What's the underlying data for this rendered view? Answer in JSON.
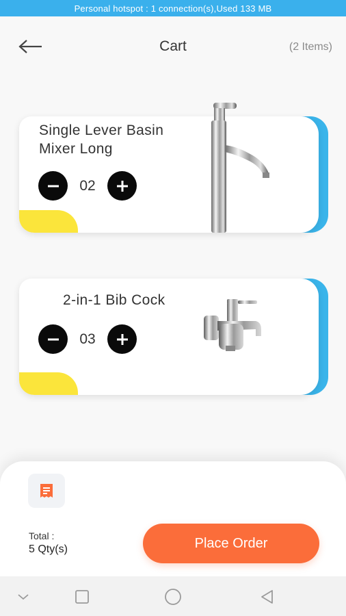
{
  "status_bar": {
    "text": "Personal hotspot : 1 connection(s),Used  133 MB"
  },
  "header": {
    "title": "Cart",
    "item_count": "(2 Items)",
    "back_icon": "arrow-left-icon"
  },
  "cart_items": [
    {
      "name_line1": "Single Lever Basin",
      "name_line2": "Mixer Long",
      "quantity": "02",
      "image": "basin-mixer-faucet"
    },
    {
      "name_line1": "2-in-1 Bib Cock",
      "quantity": "03",
      "image": "bib-cock-faucet"
    }
  ],
  "summary": {
    "total_label": "Total :",
    "total_qty": "5 Qty(s)",
    "place_order_label": "Place Order",
    "receipt_icon": "receipt-icon"
  },
  "nav": {
    "icons": [
      "nav-down-icon",
      "recents-square-icon",
      "home-circle-icon",
      "back-triangle-icon"
    ]
  },
  "colors": {
    "status_bar": "#3ab0ec",
    "card_accent": "#3ab4ea",
    "card_corner": "#fbe53b",
    "primary_button": "#fb6d3a"
  }
}
